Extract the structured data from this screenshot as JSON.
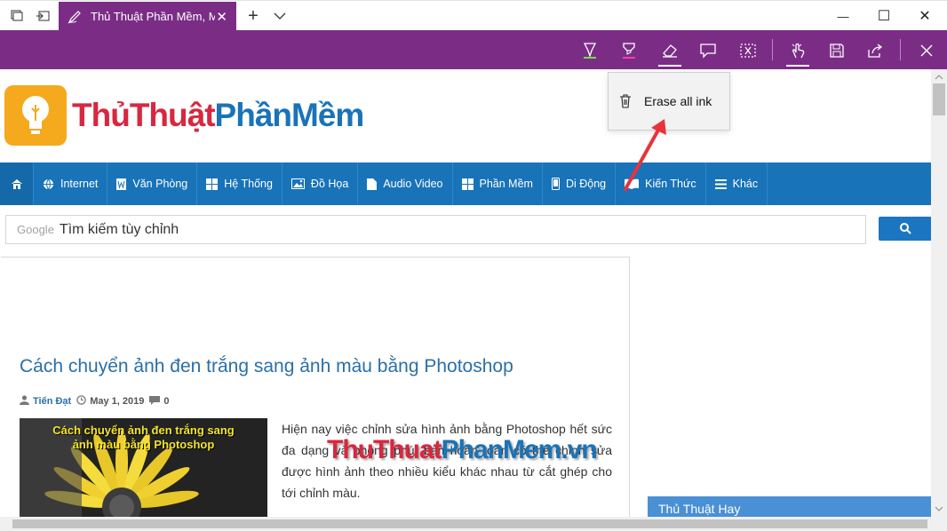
{
  "browser": {
    "tab_title": "Thủ Thuật Phần Mềm, M",
    "tab_close": "✕",
    "new_tab": "+",
    "tab_list": "⌵",
    "window_controls": {
      "minimize": "—",
      "maximize": "☐",
      "close": "✕"
    }
  },
  "ink_toolbar": {
    "tools": [
      "ballpoint-pen-icon",
      "highlighter-icon",
      "eraser-icon",
      "add-note-icon",
      "clip-icon",
      "touch-writing-icon",
      "save-icon",
      "share-icon",
      "exit-icon"
    ],
    "active": "eraser-icon",
    "pen_color": "#6ee04a",
    "highlighter_color": "#ff3fa8"
  },
  "eraser_menu": {
    "label": "Erase all ink"
  },
  "site": {
    "logo": {
      "part1": "Thủ",
      "part2": "Thuật",
      "part3": "Phần",
      "part4": "Mềm"
    },
    "nav": [
      {
        "label": "Internet",
        "icon": "globe-icon"
      },
      {
        "label": "Văn Phòng",
        "icon": "word-doc-icon"
      },
      {
        "label": "Hệ Thống",
        "icon": "windows-icon"
      },
      {
        "label": "Đồ Họa",
        "icon": "image-icon"
      },
      {
        "label": "Audio Video",
        "icon": "file-icon"
      },
      {
        "label": "Phần Mềm",
        "icon": "grid-icon"
      },
      {
        "label": "Di Động",
        "icon": "mobile-icon"
      },
      {
        "label": "Kiến Thức",
        "icon": "book-icon"
      },
      {
        "label": "Khác",
        "icon": "list-icon"
      }
    ],
    "search": {
      "brand": "Google",
      "placeholder": "Tìm kiếm tùy chỉnh"
    },
    "article": {
      "title": "Cách chuyển ảnh đen trắng sang ảnh màu bằng Photoshop",
      "author": "Tiến Đạt",
      "date": "May 1, 2019",
      "comments": "0",
      "thumb_caption": "Cách chuyển ảnh đen trắng sang ảnh màu bằng Photoshop",
      "excerpt": "Hiện nay việc chỉnh sửa hình ảnh bằng Photoshop hết sức đa dạng và phong phú, bạn hoàn toàn có thể chỉnh sửa được hình ảnh theo nhiều kiểu khác nhau từ cắt ghép cho tới chỉnh màu."
    },
    "watermark": {
      "red": "Thu",
      "red2": "Thuat",
      "blue": "PhanMem",
      "domain": ".vn"
    },
    "sidebar_heading": "Thủ Thuật Hay"
  },
  "colors": {
    "accent": "#7b2d86",
    "nav": "#1873b8",
    "annotation_arrow": "#e8333b"
  }
}
